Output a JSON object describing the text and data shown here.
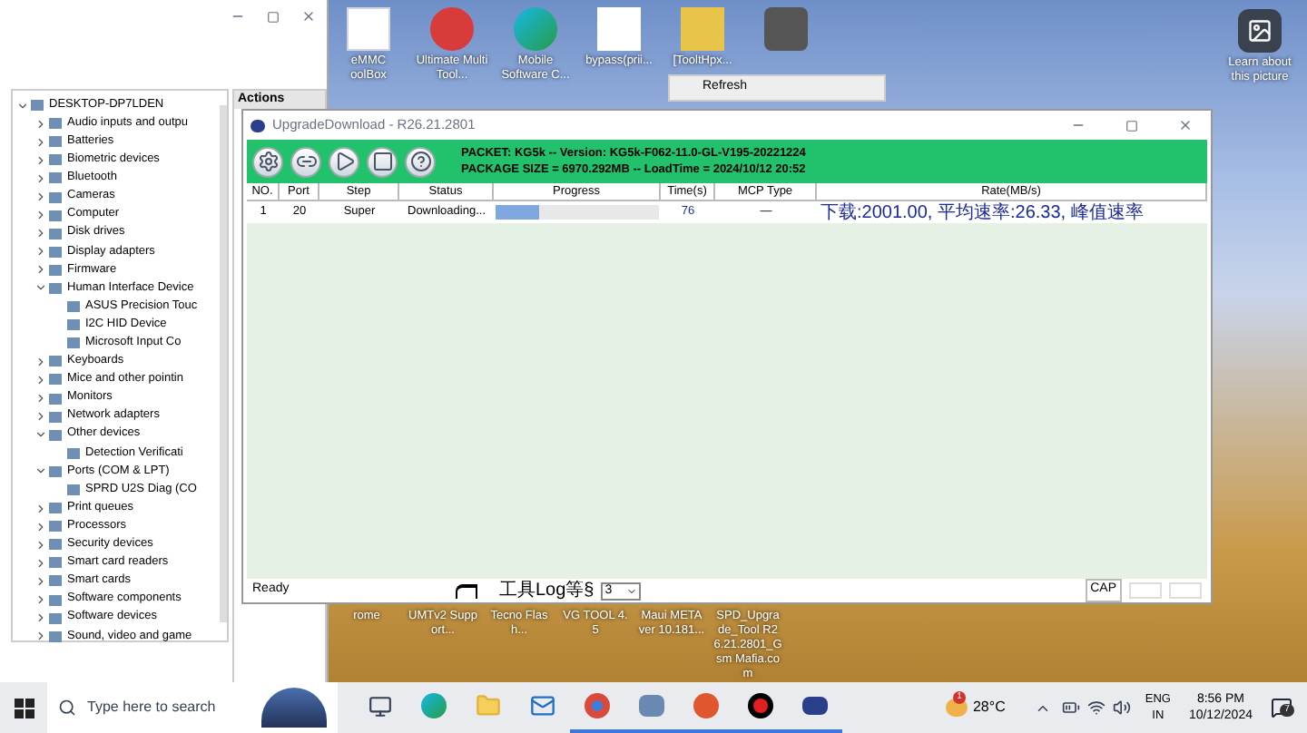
{
  "desktop_icons": [
    {
      "label": "eMMC oolBox",
      "kind": "sheet"
    },
    {
      "label": "Ultimate Multi Tool...",
      "kind": "app"
    },
    {
      "label": "Mobile Software C...",
      "kind": "browser"
    },
    {
      "label": "bypass(prii...",
      "kind": "blank"
    },
    {
      "label": "[TooltHpx...",
      "kind": "folder"
    },
    {
      "kind": "chip"
    }
  ],
  "context_menu": {
    "items": [
      "Refresh"
    ]
  },
  "learn_picture": {
    "label": "Learn about this picture"
  },
  "desktop_labels_bottom": [
    "rome",
    "UMTv2 Support...",
    "Tecno Flash...",
    "VG TOOL 4.5",
    "Maui META ver 10.181...",
    "SPD_Upgrade_Tool R26.21.2801_Gsm Mafia.com"
  ],
  "device_manager": {
    "actions_header": "Actions",
    "tree": {
      "label": "DESKTOP-DP7LDEN",
      "expanded": true,
      "children": [
        {
          "label": "Audio inputs and outpu",
          "expanded": false
        },
        {
          "label": "Batteries",
          "expanded": false
        },
        {
          "label": "Biometric devices",
          "expanded": false
        },
        {
          "label": "Bluetooth",
          "expanded": false
        },
        {
          "label": "Cameras",
          "expanded": false
        },
        {
          "label": "Computer",
          "expanded": false
        },
        {
          "label": "Disk drives",
          "expanded": false
        },
        {
          "label": "Display adapters",
          "expanded": false
        },
        {
          "label": "Firmware",
          "expanded": false
        },
        {
          "label": "Human Interface Device",
          "expanded": true,
          "children": [
            {
              "label": "ASUS Precision Touc"
            },
            {
              "label": "I2C HID Device"
            },
            {
              "label": "Microsoft Input Co"
            }
          ]
        },
        {
          "label": "Keyboards",
          "expanded": false
        },
        {
          "label": "Mice and other pointin",
          "expanded": false
        },
        {
          "label": "Monitors",
          "expanded": false
        },
        {
          "label": "Network adapters",
          "expanded": false
        },
        {
          "label": "Other devices",
          "expanded": true,
          "children": [
            {
              "label": "Detection Verificati"
            }
          ]
        },
        {
          "label": "Ports (COM & LPT)",
          "expanded": true,
          "children": [
            {
              "label": "SPRD U2S Diag (CO"
            }
          ]
        },
        {
          "label": "Print queues",
          "expanded": false
        },
        {
          "label": "Processors",
          "expanded": false
        },
        {
          "label": "Security devices",
          "expanded": false
        },
        {
          "label": "Smart card readers",
          "expanded": false
        },
        {
          "label": "Smart cards",
          "expanded": false
        },
        {
          "label": "Software components",
          "expanded": false
        },
        {
          "label": "Software devices",
          "expanded": false
        },
        {
          "label": "Sound, video and game",
          "expanded": false
        }
      ]
    }
  },
  "upgrade_window": {
    "title": "UpgradeDownload - R26.21.2801",
    "info": [
      "PACKET: KG5k -- Version: KG5k-F062-11.0-GL-V195-20221224",
      "PACKAGE SIZE = 6970.292MB -- LoadTime = 2024/10/12 20:52"
    ],
    "toolbar": [
      {
        "kind": "settings"
      },
      {
        "kind": "link"
      },
      {
        "kind": "start"
      },
      {
        "kind": "stop"
      },
      {
        "kind": "help"
      }
    ],
    "table": {
      "columns": [
        "NO.",
        "Port",
        "Step",
        "Status",
        "Progress",
        "Time(s)",
        "MCP Type",
        "Rate(MB/s)"
      ],
      "rows": [
        {
          "no": "1",
          "port": "20",
          "step": "Super",
          "status": "Downloading...",
          "level": 0.27,
          "time": "76",
          "mcp_type": "—",
          "rate": "下载:2001.00, 平均速率:26.33, 峰值速率"
        }
      ]
    },
    "status_bar": {
      "text": "Ready",
      "log_label": "工具Log等§",
      "log_level": "3",
      "cap": "CAP"
    }
  },
  "taskbar": {
    "search_placeholder": "Type here to search",
    "apps": [
      {
        "kind": "taskview",
        "running": false
      },
      {
        "kind": "edge",
        "running": false
      },
      {
        "kind": "folder",
        "running": false
      },
      {
        "kind": "mail",
        "running": false
      },
      {
        "kind": "chrome",
        "running": true
      },
      {
        "kind": "tool",
        "running": true
      },
      {
        "kind": "redapp",
        "running": true
      },
      {
        "kind": "record",
        "running": true
      },
      {
        "kind": "flash",
        "running": true
      }
    ],
    "weather": {
      "badge": "1",
      "temp": "28°C"
    },
    "lang": [
      "ENG",
      "IN"
    ],
    "time": "8:56 PM",
    "date": "10/12/2024",
    "notifications": "7"
  }
}
